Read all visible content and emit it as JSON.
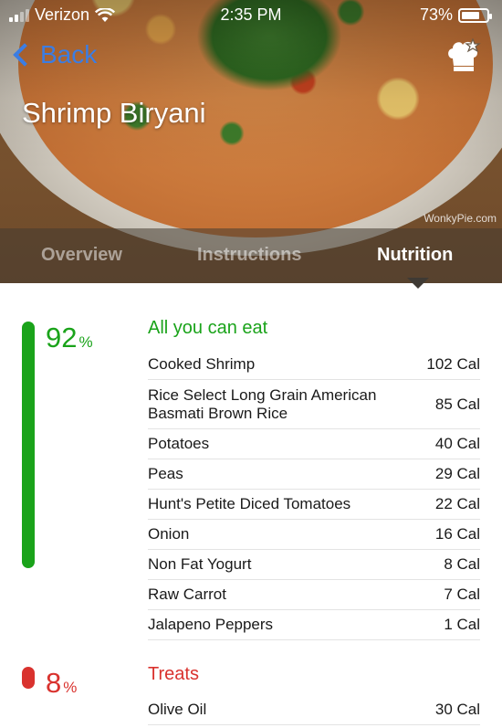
{
  "status_bar": {
    "carrier": "Verizon",
    "time": "2:35 PM",
    "battery": "73%",
    "battery_level": 0.73
  },
  "nav": {
    "back_label": "Back",
    "title": "Shrimp Biryani"
  },
  "watermark": "WonkyPie.com",
  "tabs": [
    {
      "label": "Overview",
      "active": false
    },
    {
      "label": "Instructions",
      "active": false
    },
    {
      "label": "Nutrition",
      "active": true
    }
  ],
  "nutrition": {
    "all_you_can_eat": {
      "title": "All you can eat",
      "percent": "92",
      "percent_sign": "%",
      "color": "#1aa31a",
      "items": [
        {
          "name": "Cooked Shrimp",
          "cal": "102 Cal"
        },
        {
          "name": "Rice Select Long Grain American Basmati Brown Rice",
          "cal": "85 Cal"
        },
        {
          "name": "Potatoes",
          "cal": "40 Cal"
        },
        {
          "name": "Peas",
          "cal": "29 Cal"
        },
        {
          "name": "Hunt's Petite Diced Tomatoes",
          "cal": "22 Cal"
        },
        {
          "name": "Onion",
          "cal": "16 Cal"
        },
        {
          "name": "Non Fat Yogurt",
          "cal": "8 Cal"
        },
        {
          "name": "Raw Carrot",
          "cal": "7 Cal"
        },
        {
          "name": "Jalapeno Peppers",
          "cal": "1 Cal"
        }
      ]
    },
    "treats": {
      "title": "Treats",
      "percent": "8",
      "percent_sign": "%",
      "color": "#d9322e",
      "items": [
        {
          "name": "Olive Oil",
          "cal": "30 Cal"
        }
      ]
    }
  },
  "icons": {
    "back": "chevron-left-icon",
    "favorite": "chef-hat-star-icon",
    "wifi": "wifi-icon",
    "signal": "signal-icon",
    "battery": "battery-icon"
  }
}
